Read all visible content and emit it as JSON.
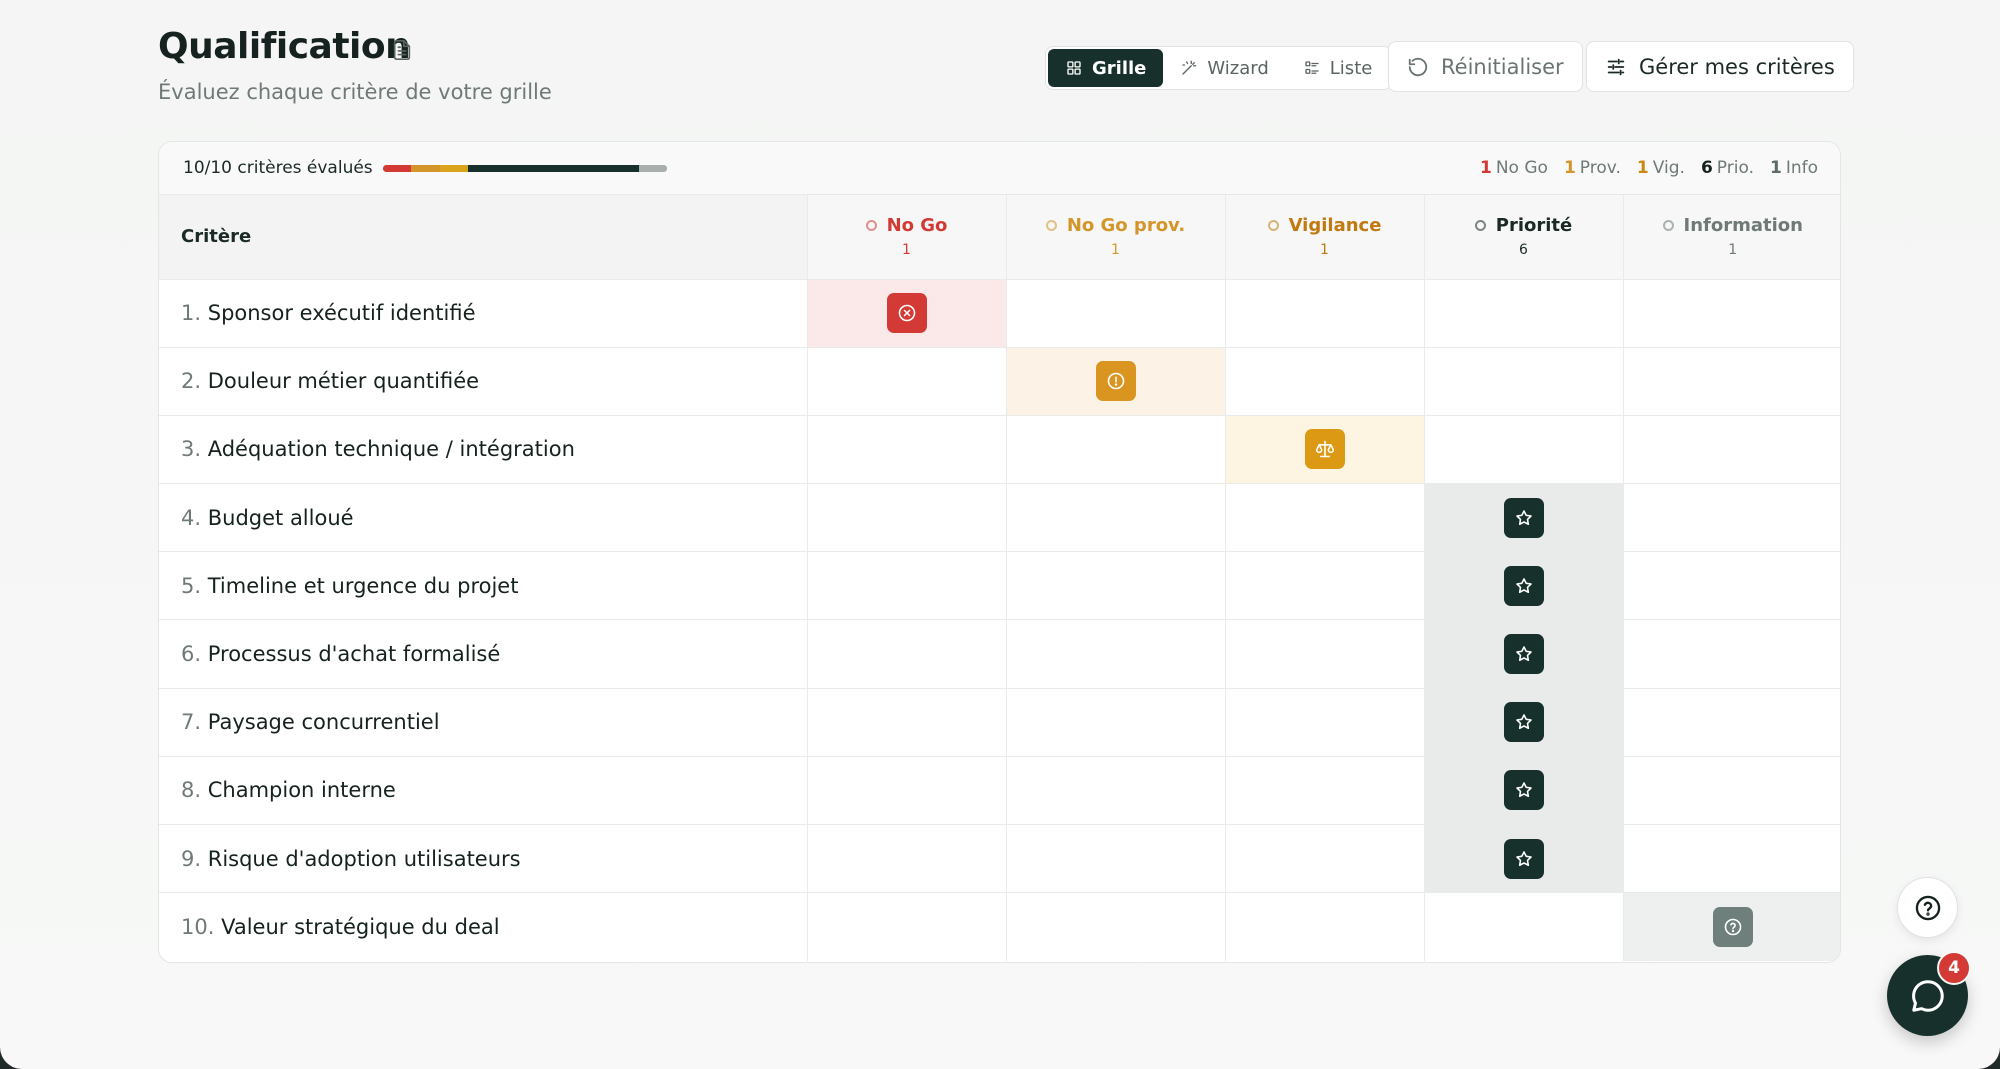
{
  "header": {
    "title": "Qualification",
    "subtitle": "Évaluez chaque critère de votre grille"
  },
  "toolbar": {
    "views": [
      {
        "label": "Grille",
        "icon": "grid-icon",
        "active": true
      },
      {
        "label": "Wizard",
        "icon": "wand-icon",
        "active": false
      },
      {
        "label": "Liste",
        "icon": "list-icon",
        "active": false
      }
    ],
    "reset_label": "Réinitialiser",
    "manage_label": "Gérer mes critères"
  },
  "summary": {
    "evaluated": "10/10 critères évalués",
    "progress_segments": [
      {
        "fraction": 0.1,
        "color": "#d33a35"
      },
      {
        "fraction": 0.1,
        "color": "#d4962a"
      },
      {
        "fraction": 0.1,
        "color": "#d9a31c"
      },
      {
        "fraction": 0.6,
        "color": "#17302b"
      },
      {
        "fraction": 0.1,
        "color": "#a8afad"
      }
    ],
    "counts": [
      {
        "value": "1",
        "label": "No Go",
        "color": "#d33a35"
      },
      {
        "value": "1",
        "label": "Prov.",
        "color": "#d4962a"
      },
      {
        "value": "1",
        "label": "Vig.",
        "color": "#c88a12"
      },
      {
        "value": "6",
        "label": "Prio.",
        "color": "#15221f"
      },
      {
        "value": "1",
        "label": "Info",
        "color": "#5e6b67"
      }
    ]
  },
  "table": {
    "criteria_header": "Critère",
    "columns": [
      {
        "label": "No Go",
        "count": "1",
        "color": "#d33a35",
        "cell_bg": "#fbe9e9",
        "marker_bg": "#d33a35",
        "icon": "x-circle-icon"
      },
      {
        "label": "No Go prov.",
        "count": "1",
        "color": "#d4962a",
        "cell_bg": "#fdf2e6",
        "marker_bg": "#d9951f",
        "icon": "alert-circle-icon"
      },
      {
        "label": "Vigilance",
        "count": "1",
        "color": "#c07a10",
        "cell_bg": "#fdf5e1",
        "marker_bg": "#dc9a14",
        "icon": "scale-icon"
      },
      {
        "label": "Priorité",
        "count": "6",
        "color": "#1c2a27",
        "cell_bg": "#e9eaea",
        "marker_bg": "#17302b",
        "icon": "star-icon"
      },
      {
        "label": "Information",
        "count": "1",
        "color": "#6f7a77",
        "cell_bg": "#eef0ef",
        "marker_bg": "#6f7f7b",
        "icon": "help-circle-icon"
      }
    ],
    "rows": [
      {
        "num": "1.",
        "label": "Sponsor exécutif identifié",
        "selected": 0
      },
      {
        "num": "2.",
        "label": "Douleur métier quantifiée",
        "selected": 1
      },
      {
        "num": "3.",
        "label": "Adéquation technique / intégration",
        "selected": 2
      },
      {
        "num": "4.",
        "label": "Budget alloué",
        "selected": 3
      },
      {
        "num": "5.",
        "label": "Timeline et urgence du projet",
        "selected": 3
      },
      {
        "num": "6.",
        "label": "Processus d'achat formalisé",
        "selected": 3
      },
      {
        "num": "7.",
        "label": "Paysage concurrentiel",
        "selected": 3
      },
      {
        "num": "8.",
        "label": "Champion interne",
        "selected": 3
      },
      {
        "num": "9.",
        "label": "Risque d'adoption utilisateurs",
        "selected": 3
      },
      {
        "num": "10.",
        "label": "Valeur stratégique du deal",
        "selected": 4
      }
    ]
  },
  "fab": {
    "help_icon": "help-circle-icon",
    "chat_icon": "chat-bubble-icon",
    "chat_badge": "4"
  }
}
